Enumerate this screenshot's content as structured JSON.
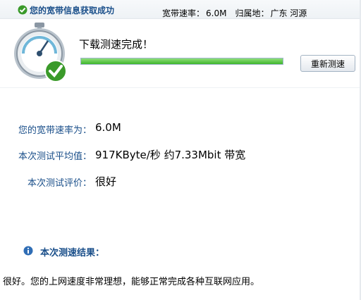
{
  "topbar": {
    "status_text": "您的宽带信息获取成功",
    "speed_label": "宽带速率：",
    "speed_value": "6.0M",
    "location_label": "归属地：",
    "location_value": "广东 河源"
  },
  "test": {
    "done_title": "下载测速完成！",
    "progress_fraction": 1.0,
    "retest_label": "重新测速"
  },
  "results": [
    {
      "label": "您的宽带速率为：",
      "value": "6.0M"
    },
    {
      "label": "本次测试平均值：",
      "value": "917KByte/秒 约7.33Mbit 带宽"
    },
    {
      "label": "本次测试评价：",
      "value": "很好"
    }
  ],
  "summary": {
    "title": "本次测速结果：",
    "text": "很好。您的上网速度非常理想，能够正常完成各种互联网应用。"
  },
  "colors": {
    "accent": "#1a4f8a",
    "progress": "#3fb52b",
    "check": "#3a9a2a"
  },
  "icons": {
    "top_status": "check-circle-icon",
    "gauge": "stopwatch-gauge-icon",
    "summary": "info-icon"
  }
}
